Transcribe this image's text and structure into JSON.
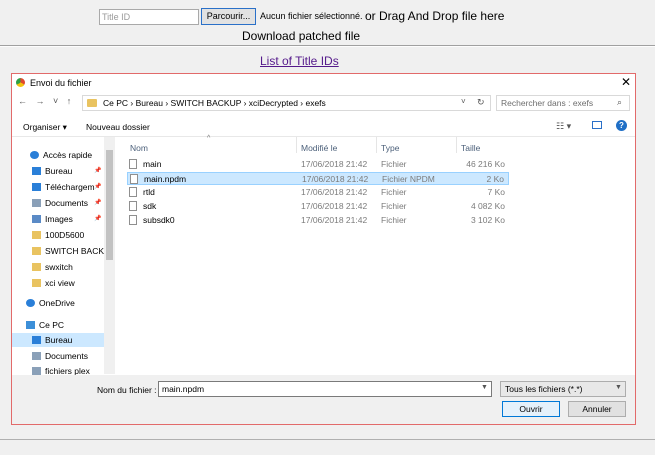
{
  "page": {
    "title_input_placeholder": "Title ID",
    "browse_label": "Parcourir...",
    "no_file_label": "Aucun fichier sélectionné.",
    "drag_drop_label": "or Drag And Drop file here",
    "download_label": "Download patched file",
    "title_link_label": "List of Title IDs"
  },
  "dialog": {
    "title": "Envoi du fichier",
    "close_glyph": "✕",
    "nav_arrows": "← → ˅ ↑",
    "address": "Ce PC  ›  Bureau  ›  SWITCH BACKUP  ›  xciDecrypted  ›  exefs",
    "search_placeholder": "Rechercher dans : exefs",
    "toolbar": {
      "organiser": "Organiser ▾",
      "nouveau": "Nouveau dossier"
    },
    "nav": [
      {
        "label": "Accès rapide",
        "icon": "star-icon",
        "color": "#2a7fd8"
      },
      {
        "label": "Bureau",
        "icon": "desktop-icon",
        "color": "#2a7fd8",
        "pinned": true
      },
      {
        "label": "Téléchargem",
        "icon": "download-icon",
        "color": "#2a7fd8",
        "pinned": true
      },
      {
        "label": "Documents",
        "icon": "documents-icon",
        "color": "#8aa0b8",
        "pinned": true
      },
      {
        "label": "Images",
        "icon": "images-icon",
        "color": "#5a8ac6",
        "pinned": true
      },
      {
        "label": "100D5600",
        "icon": "folder-icon",
        "color": "#e9c360"
      },
      {
        "label": "SWITCH BACKU",
        "icon": "folder-icon",
        "color": "#e9c360"
      },
      {
        "label": "swxitch",
        "icon": "folder-icon",
        "color": "#e9c360"
      },
      {
        "label": "xci view",
        "icon": "folder-icon",
        "color": "#e9c360"
      },
      {
        "label": "OneDrive",
        "icon": "cloud-icon",
        "color": "#2a7fd8"
      },
      {
        "label": "Ce PC",
        "icon": "computer-icon",
        "color": "#3c8fd8"
      },
      {
        "label": "Bureau",
        "icon": "desktop-icon",
        "color": "#2a7fd8",
        "selected": true
      },
      {
        "label": "Documents",
        "icon": "documents-icon",
        "color": "#8aa0b8"
      },
      {
        "label": "fichiers plex",
        "icon": "documents-icon",
        "color": "#8aa0b8"
      }
    ],
    "columns": [
      "Nom",
      "Modifié le",
      "Type",
      "Taille"
    ],
    "files": [
      {
        "name": "main",
        "date": "17/06/2018 21:42",
        "type": "Fichier",
        "size": "46 216 Ko"
      },
      {
        "name": "main.npdm",
        "date": "17/06/2018 21:42",
        "type": "Fichier NPDM",
        "size": "2 Ko",
        "selected": true
      },
      {
        "name": "rtld",
        "date": "17/06/2018 21:42",
        "type": "Fichier",
        "size": "7 Ko"
      },
      {
        "name": "sdk",
        "date": "17/06/2018 21:42",
        "type": "Fichier",
        "size": "4 082 Ko"
      },
      {
        "name": "subsdk0",
        "date": "17/06/2018 21:42",
        "type": "Fichier",
        "size": "3 102 Ko"
      }
    ],
    "filename_label": "Nom du fichier :",
    "filename_value": "main.npdm",
    "filter_value": "Tous les fichiers (*.*)",
    "open_label": "Ouvrir",
    "cancel_label": "Annuler"
  }
}
